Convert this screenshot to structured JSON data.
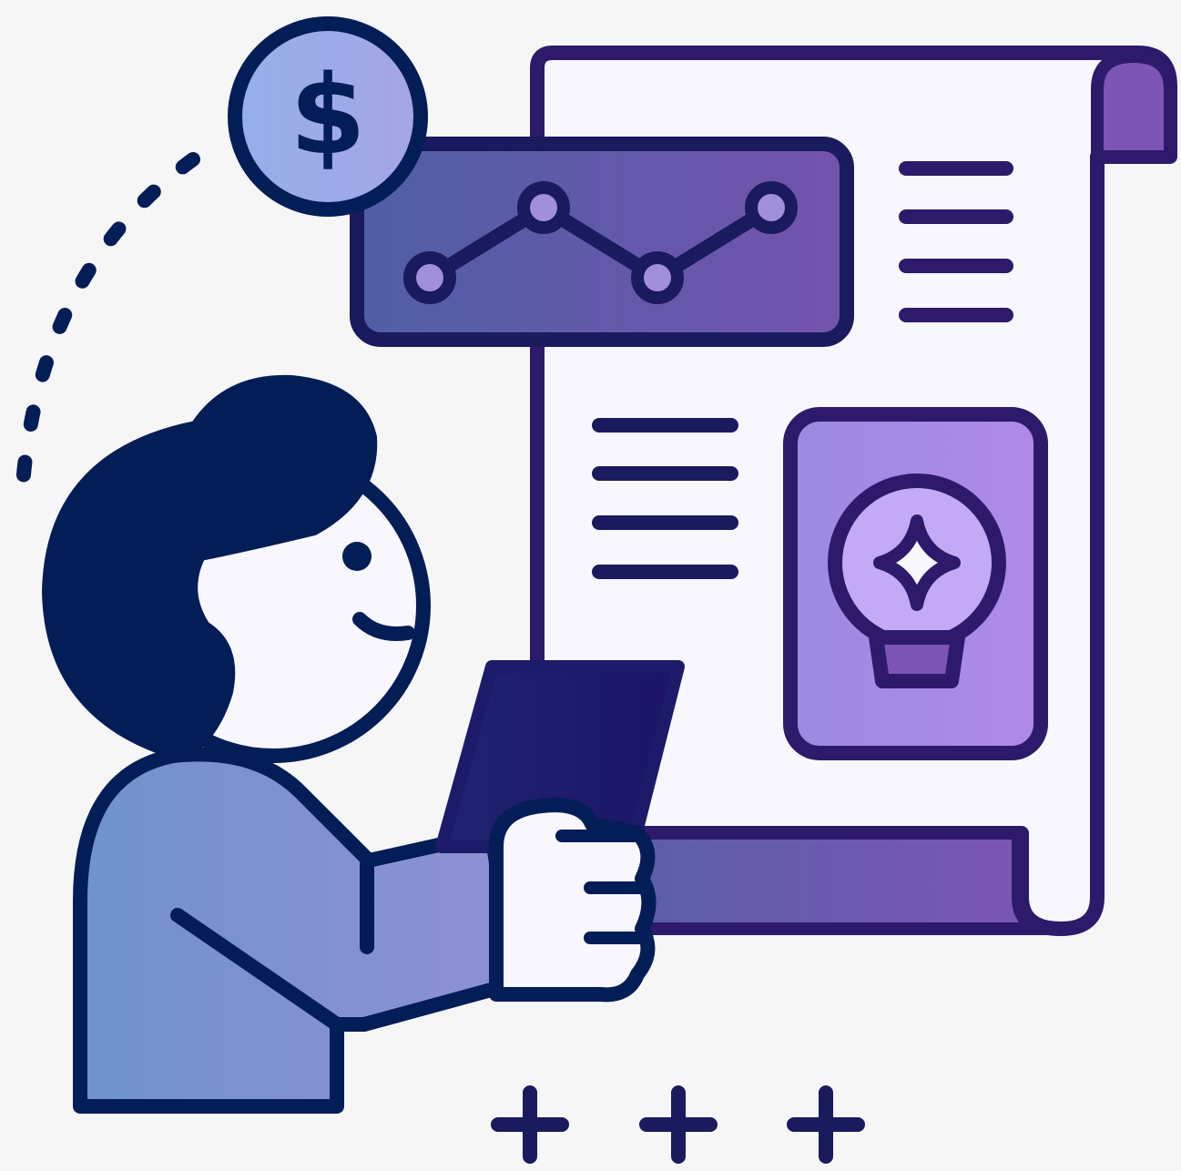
{
  "illustration": {
    "coin": {
      "symbol": "$",
      "icon": "dollar-coin-icon"
    },
    "chart_card": {
      "icon": "line-chart-icon"
    },
    "idea_card": {
      "icon": "lightbulb-sparkle-icon"
    },
    "decorations": {
      "icon": "plus-icon",
      "count": 3
    }
  },
  "palette": {
    "background": "#f6f6f7",
    "outline": "#1a1a5e",
    "outline_purple": "#2d1a6b",
    "paper": "#f8f7fd",
    "hair": "#031d57",
    "shirt_start": "#6f93cc",
    "shirt_end": "#8f90d1",
    "coin_start": "#93b1e8",
    "coin_end": "#a6a4e6",
    "chart_start": "#4f5fa5",
    "chart_end": "#7353ad",
    "accent_purple": "#7d55b4",
    "idea_start": "#9b8be0",
    "idea_end": "#b08ae6",
    "bulb_glow": "#c4a9f5",
    "tablet": "#1c1b6a"
  }
}
